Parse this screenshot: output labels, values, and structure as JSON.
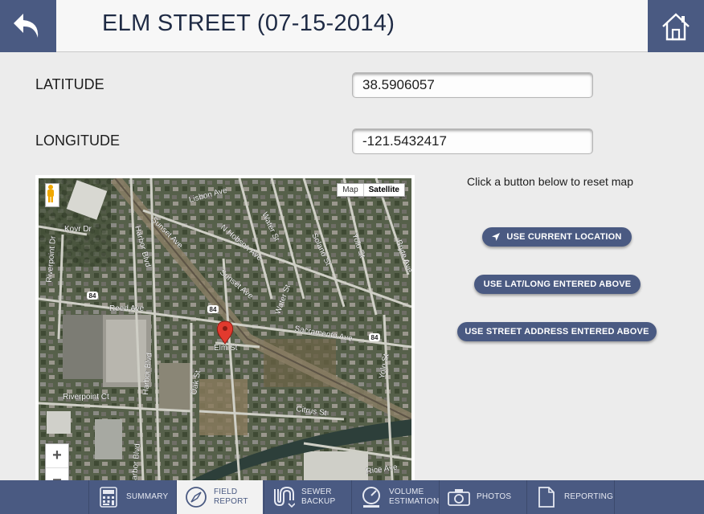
{
  "header": {
    "title": "ELM STREET (07-15-2014)",
    "back_icon": "back-arrow-icon",
    "home_icon": "home-icon"
  },
  "form": {
    "latitude_label": "LATITUDE",
    "latitude_value": "38.5906057",
    "longitude_label": "LONGITUDE",
    "longitude_value": "-121.5432417"
  },
  "map": {
    "type_map": "Map",
    "type_satellite": "Satellite",
    "zoom_in": "+",
    "zoom_out": "−",
    "streets": {
      "lisbon": "Lisbon Ave",
      "kovr": "Kovr Dr",
      "sunset1": "Sunset Ave",
      "sunset2": "Sunset Ave",
      "hobson": "N Hobson Ave",
      "water1": "Water St",
      "water2": "Water St",
      "solano": "Solano St",
      "yolo1": "Yolo St",
      "yolo2": "Yolo St",
      "bryte": "Bryte Ave",
      "riverpoint_dr": "Riverpoint Dr",
      "harbor1": "Harbor Blvd",
      "harbor2": "Harbor Blvd",
      "harbor3": "arbor Blvd",
      "reed": "Reed Ave",
      "sacramento": "Sacramento Ave",
      "elm": "Elm St",
      "oak": "Oak St",
      "riverpoint_ct": "Riverpoint Ct",
      "citrus": "Citrus St",
      "rice": "Rice Ave",
      "route1": "84",
      "route2": "84",
      "route3": "84"
    }
  },
  "panel": {
    "reset_text": "Click a button below to reset map",
    "btn_current": "USE CURRENT LOCATION",
    "btn_latlong": "USE LAT/LONG ENTERED ABOVE",
    "btn_address": "USE STREET ADDRESS ENTERED ABOVE"
  },
  "tabs": [
    {
      "label": "SUMMARY",
      "icon": "calculator-icon"
    },
    {
      "label1": "FIELD",
      "label2": "REPORT",
      "icon": "compass-icon"
    },
    {
      "label1": "SEWER",
      "label2": "BACKUP",
      "icon": "pipe-icon"
    },
    {
      "label1": "VOLUME",
      "label2": "ESTIMATION",
      "icon": "gauge-icon"
    },
    {
      "label": "PHOTOS",
      "icon": "camera-icon"
    },
    {
      "label": "REPORTING",
      "icon": "document-icon"
    }
  ],
  "colors": {
    "brand": "#4a5a82",
    "background": "#ececec",
    "map_pin": "#e23a2e"
  }
}
